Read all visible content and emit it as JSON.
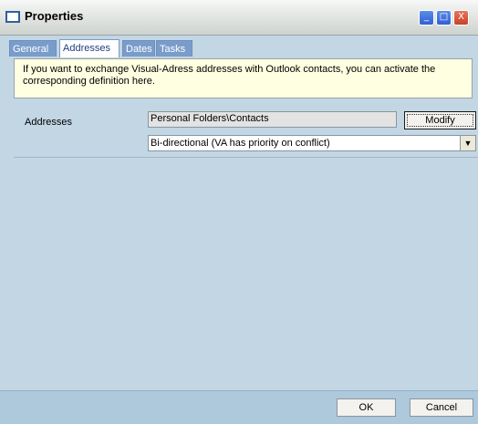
{
  "window": {
    "title": "Properties",
    "controls": {
      "minimize": "_",
      "maximize": "□",
      "close": "X"
    }
  },
  "tabs": [
    {
      "label": "General",
      "active": false
    },
    {
      "label": "Addresses",
      "active": true
    },
    {
      "label": "Dates",
      "active": false
    },
    {
      "label": "Tasks",
      "active": false
    }
  ],
  "info_text": "If you want to exchange Visual-Adress addresses with Outlook contacts, you can activate the corresponding definition here.",
  "addresses": {
    "label": "Addresses",
    "folder_value": "Personal Folders\\Contacts",
    "modify_label": "Modify",
    "sync_mode": "Bi-directional (VA has priority on conflict)"
  },
  "footer": {
    "ok_label": "OK",
    "cancel_label": "Cancel"
  },
  "colors": {
    "background": "#c2d6e4",
    "tab_active_text": "#1f3f86",
    "info_background": "#ffffe1"
  }
}
